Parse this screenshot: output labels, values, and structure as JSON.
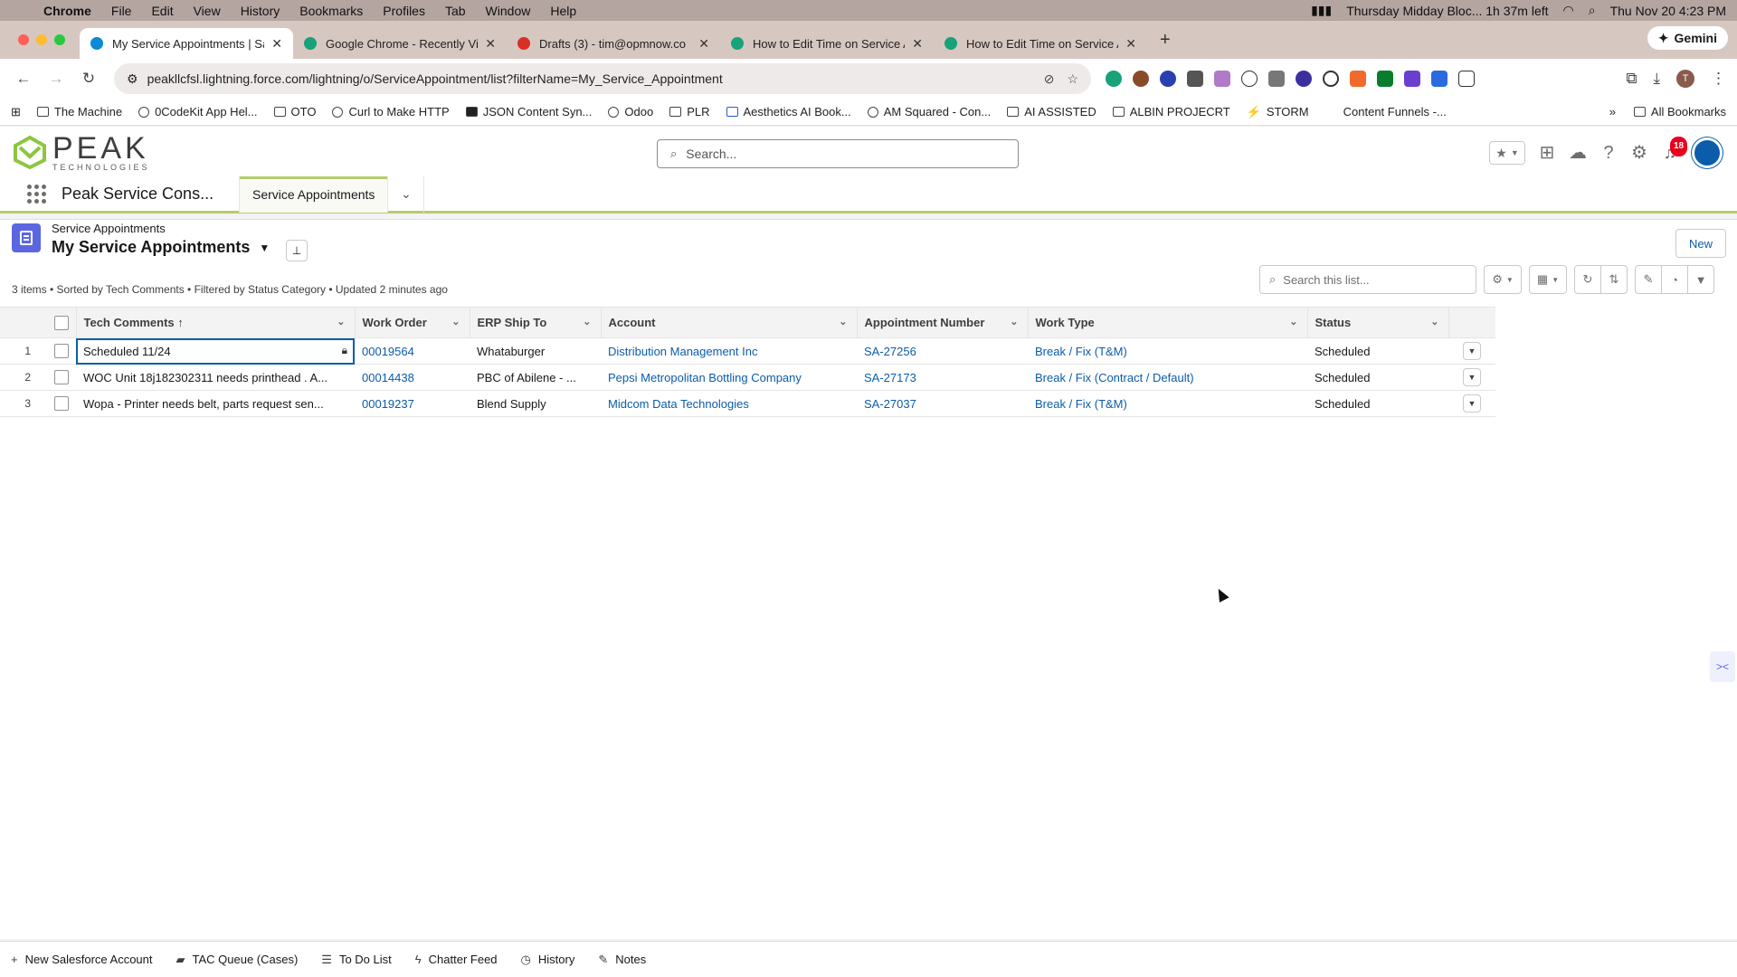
{
  "mac_menu": {
    "items": [
      "Chrome",
      "File",
      "Edit",
      "View",
      "History",
      "Bookmarks",
      "Profiles",
      "Tab",
      "Window",
      "Help"
    ],
    "status_text": "Thursday Midday Bloc... 1h 37m left",
    "datetime": "Thu Nov 20  4:23 PM"
  },
  "browser": {
    "tabs": [
      {
        "title": "My Service Appointments | Sa",
        "color": "#0b8ad8"
      },
      {
        "title": "Google Chrome - Recently Vi",
        "color": "#17a27a"
      },
      {
        "title": "Drafts (3) - tim@opmnow.co",
        "color": "#d93025"
      },
      {
        "title": "How to Edit Time on Service A",
        "color": "#17a27a"
      },
      {
        "title": "How to Edit Time on Service A",
        "color": "#17a27a"
      }
    ],
    "gemini_label": "Gemini",
    "url": "peakllcfsl.lightning.force.com/lightning/o/ServiceAppointment/list?filterName=My_Service_Appointment",
    "profile_initial": "T",
    "bookmarks": [
      "The Machine",
      "0CodeKit App Hel...",
      "OTO",
      "Curl to Make HTTP",
      "JSON Content Syn...",
      "Odoo",
      "PLR",
      "Aesthetics AI Book...",
      "AM Squared - Con...",
      "AI ASSISTED",
      "ALBIN PROJECRT",
      "STORM",
      "Content Funnels -..."
    ],
    "all_bookmarks": "All Bookmarks"
  },
  "sf": {
    "logo_text": "PEAK",
    "logo_sub": "TECHNOLOGIES",
    "search_placeholder": "Search...",
    "notification_count": "18",
    "app_name": "Peak Service Cons...",
    "nav_tab": "Service Appointments"
  },
  "list": {
    "object_label": "Service Appointments",
    "view_name": "My Service Appointments",
    "new_button": "New",
    "meta": "3 items • Sorted by Tech Comments • Filtered by Status Category • Updated 2 minutes ago",
    "search_placeholder": "Search this list...",
    "columns": [
      "Tech Comments",
      "Work Order",
      "ERP Ship To",
      "Account",
      "Appointment Number",
      "Work Type",
      "Status"
    ],
    "sort_indicator": "↑",
    "rows": [
      {
        "num": "1",
        "comments": "Scheduled 11/24",
        "work_order": "00019564",
        "ship_to": "Whataburger",
        "account": "Distribution Management Inc",
        "appt": "SA-27256",
        "work_type": "Break / Fix (T&M)",
        "status": "Scheduled"
      },
      {
        "num": "2",
        "comments": "WOC Unit 18j182302311 needs printhead . A...",
        "work_order": "00014438",
        "ship_to": "PBC of Abilene - ...",
        "account": "Pepsi Metropolitan Bottling Company",
        "appt": "SA-27173",
        "work_type": "Break / Fix (Contract / Default)",
        "status": "Scheduled"
      },
      {
        "num": "3",
        "comments": "Wopa - Printer needs belt, parts request sen...",
        "work_order": "00019237",
        "ship_to": "Blend Supply",
        "account": "Midcom Data Technologies",
        "appt": "SA-27037",
        "work_type": "Break / Fix (T&M)",
        "status": "Scheduled"
      }
    ]
  },
  "utility": [
    "New Salesforce Account",
    "TAC Queue (Cases)",
    "To Do List",
    "Chatter Feed",
    "History",
    "Notes"
  ]
}
